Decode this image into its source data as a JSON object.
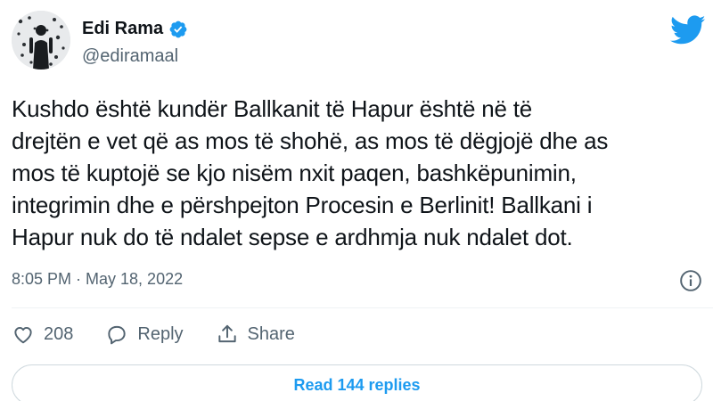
{
  "author": {
    "display_name": "Edi Rama",
    "handle": "@ediramaal"
  },
  "tweet": {
    "lines": [
      "Kushdo është kundër Ballkanit të Hapur është në të",
      "drejtën e vet që as mos të shohë, as mos të dëgjojë dhe as",
      "mos të kuptojë se kjo nisëm nxit paqen, bashkëpunimin,",
      "integrimin dhe e përshpejton Procesin e Berlinit! Ballkani i",
      "Hapur nuk do të ndalet sepse e ardhmja nuk ndalet dot."
    ],
    "timestamp": "8:05 PM · May 18, 2022"
  },
  "actions": {
    "like_count": "208",
    "reply_label": "Reply",
    "share_label": "Share"
  },
  "read_replies_label": "Read 144 replies",
  "colors": {
    "accent": "#1d9bf0",
    "text": "#0f1419",
    "secondary": "#536471"
  },
  "icons": [
    "verified-badge-icon",
    "twitter-bird-icon",
    "info-icon",
    "heart-icon",
    "reply-bubble-icon",
    "share-icon"
  ]
}
